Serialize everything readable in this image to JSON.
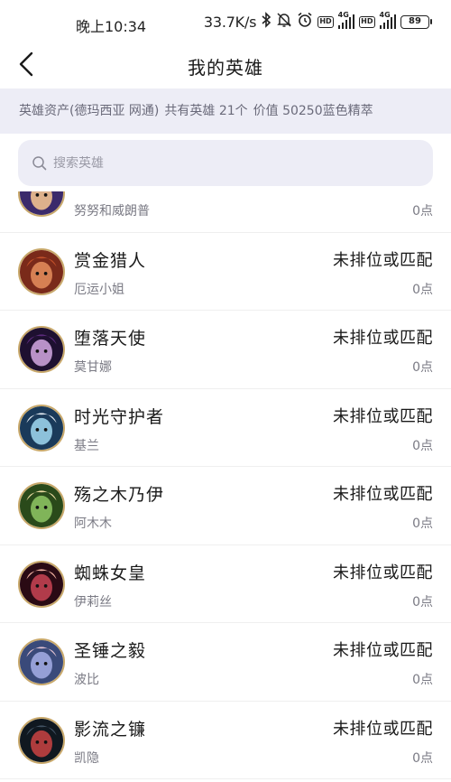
{
  "status_bar": {
    "time": "晚上10:34",
    "net_speed": "33.7K/s",
    "hd1": "HD",
    "hd2": "HD",
    "sig1_label": "4G",
    "sig2_label": "4G",
    "battery": "89"
  },
  "header": {
    "title": "我的英雄",
    "back_icon": "chevron-left-icon"
  },
  "summary": {
    "assets": "英雄资产(德玛西亚 网通)",
    "count": "共有英雄 21个",
    "value": "价值 50250蓝色精萃"
  },
  "search": {
    "placeholder": "搜索英雄",
    "icon": "search-icon"
  },
  "colors": {
    "summary_bg": "#ededf6",
    "avatar_border": "#c8a86a"
  },
  "heroes": [
    {
      "title": "",
      "name": "努努和威朗普",
      "rank": "",
      "points": "0点",
      "colors": [
        "#3b2a6b",
        "#f0c090",
        "#6a4fb0"
      ]
    },
    {
      "title": "赏金猎人",
      "name": "厄运小姐",
      "rank": "未排位或匹配",
      "points": "0点",
      "colors": [
        "#7a2a1a",
        "#e08a5a",
        "#c0502a"
      ]
    },
    {
      "title": "堕落天使",
      "name": "莫甘娜",
      "rank": "未排位或匹配",
      "points": "0点",
      "colors": [
        "#1e1030",
        "#c9a0d8",
        "#5a2a7a"
      ]
    },
    {
      "title": "时光守护者",
      "name": "基兰",
      "rank": "未排位或匹配",
      "points": "0点",
      "colors": [
        "#1a3a5a",
        "#9ad0e8",
        "#e0e8f0"
      ]
    },
    {
      "title": "殇之木乃伊",
      "name": "阿木木",
      "rank": "未排位或匹配",
      "points": "0点",
      "colors": [
        "#2a4a1a",
        "#8ac060",
        "#e8d8a0"
      ]
    },
    {
      "title": "蜘蛛女皇",
      "name": "伊莉丝",
      "rank": "未排位或匹配",
      "points": "0点",
      "colors": [
        "#2a0a14",
        "#c04050",
        "#f0b0a0"
      ]
    },
    {
      "title": "圣锤之毅",
      "name": "波比",
      "rank": "未排位或匹配",
      "points": "0点",
      "colors": [
        "#3a4a7a",
        "#a0a8e0",
        "#e0c0d0"
      ]
    },
    {
      "title": "影流之镰",
      "name": "凯隐",
      "rank": "未排位或匹配",
      "points": "0点",
      "colors": [
        "#101820",
        "#c04040",
        "#405060"
      ]
    }
  ]
}
